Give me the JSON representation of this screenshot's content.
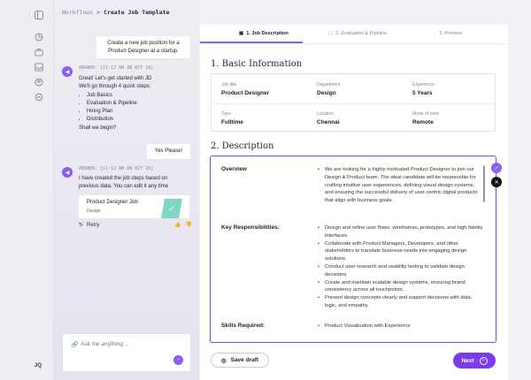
{
  "breadcrumb": {
    "root": "Workflows",
    "separator": ">",
    "current": "Create Job Template"
  },
  "chat": {
    "user_message_1": [
      "Create a new job position for a",
      "Product Designer at a startup."
    ],
    "bot_message_1": {
      "sender": "ANSWER:",
      "timestamp": "[11:12 AM ON OCT 10]",
      "line1": "Great! Let's get started with JD",
      "line2": "We'll go through 4 quick steps:",
      "steps": [
        "Job Basics",
        "Evaluation & Pipeline",
        "Hiring Plan",
        "Distribution"
      ],
      "closing": "Shall we begin?"
    },
    "user_message_2": "Yes Please!",
    "bot_message_2": {
      "sender": "ANSWER:",
      "timestamp": "[11:12 AM ON OCT 10]",
      "text": "I have created the job steps based on previous data. You can edit it any time"
    },
    "template_card": {
      "title": "Product Designer Job",
      "subtitle": "Design"
    },
    "retry_label": "Retry",
    "input_placeholder": "Ask me anything ..."
  },
  "sidebar": {
    "avatar_initials": "JQ"
  },
  "steps": [
    {
      "label": "1. Job Description",
      "active": true
    },
    {
      "label": "2. Evaluation & Pipeline",
      "active": false
    },
    {
      "label": "3. Preview",
      "active": false
    }
  ],
  "basic_info": {
    "heading": "1. Basic Information",
    "fields": [
      {
        "label": "Job title",
        "value": "Product Designer"
      },
      {
        "label": "Department",
        "value": "Design"
      },
      {
        "label": "Experience",
        "value": "5 Years"
      },
      {
        "label": "Type",
        "value": "Fulltime"
      },
      {
        "label": "Location",
        "value": "Chennai"
      },
      {
        "label": "Mode of work",
        "value": "Remote"
      }
    ]
  },
  "description": {
    "heading": "2. Description",
    "overview_label": "Overview",
    "overview": [
      "We are looking for a highly motivated Product Designer to join our Design & Product team. The ideal candidate will be responsible for crafting intuitive user experiences, defining visual design systems, and ensuring the successful delivery of user-centric digital products that align with business goals."
    ],
    "responsibilities_label": "Key Responsibilities:",
    "responsibilities": [
      "Design and refine user flows, wireframes, prototypes, and high fidelity interfaces.",
      "Collaborate with Product Managers, Developers, and other stakeholders to translate business needs into engaging design solutions.",
      "Conduct user research and usability testing to validate design decisions.",
      "Create and maintain scalable design systems, ensuring brand consistency across all touchpoints.",
      "Present design concepts clearly and support decisions with data, logic, and empathy."
    ],
    "skills_label": "Skills Required:",
    "skills": [
      "Product Visualisation with Experience"
    ]
  },
  "footer": {
    "save_label": "Save draft",
    "next_label": "Next"
  },
  "colors": {
    "accent": "#7c3aed",
    "accent_light": "#8b5cf6",
    "border_active": "#6d4ee0"
  }
}
